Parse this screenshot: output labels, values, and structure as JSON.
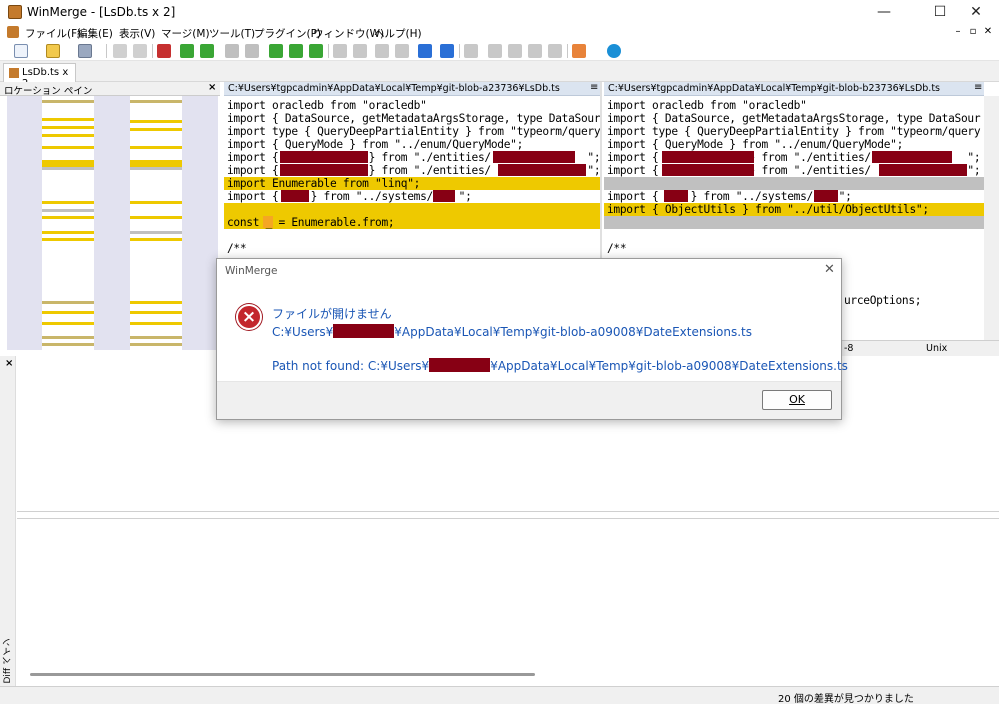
{
  "window": {
    "title": "WinMerge - [LsDb.ts x 2]",
    "controls": {
      "minimize": "—",
      "maximize": "☐",
      "close": "✕"
    }
  },
  "menubar": {
    "items": [
      "ファイル(F)",
      "編集(E)",
      "表示(V)",
      "マージ(M)",
      "ツール(T)",
      "プラグイン(P)",
      "ウィンドウ(W)",
      "ヘルプ(H)"
    ],
    "mdi_controls": [
      "–",
      "▫",
      "✕"
    ]
  },
  "tabs": [
    {
      "label": "LsDb.ts x 2"
    }
  ],
  "location_pane": {
    "title": "ロケーション ペイン",
    "close": "×"
  },
  "left_pane": {
    "path": "C:¥Users¥tgpcadmin¥AppData¥Local¥Temp¥git-blob-a23736¥LsDb.ts",
    "menu": "≡",
    "lines": [
      "import oracledb from \"oracledb\"",
      "import { DataSource, getMetadataArgsStorage, type DataSour",
      "import type { QueryDeepPartialEntity } from \"typeorm/query",
      "import { QueryMode } from \"../enum/QueryMode\";",
      "import {              } from \"./entities/               \";",
      "import {              } from \"./entities/               \";",
      "import Enumerable from \"linq\";",
      "import {     } from \"../systems/    \";",
      "",
      "const _ = Enumerable.from;",
      "",
      "/**"
    ]
  },
  "right_pane": {
    "path": "C:¥Users¥tgpcadmin¥AppData¥Local¥Temp¥git-blob-b23736¥LsDb.ts",
    "menu": "≡",
    "lines": [
      "import oracledb from \"oracledb\"",
      "import { DataSource, getMetadataArgsStorage, type DataSour",
      "import type { QueryDeepPartialEntity } from \"typeorm/query",
      "import { QueryMode } from \"../enum/QueryMode\";",
      "import {              } from \"./entities/               \";",
      "import {              } from \"./entities/               \";",
      "",
      "import {     } from \"../systems/    \";",
      "import { ObjectUtils } from \"../util/ObjectUtils\";",
      "",
      "",
      "/**"
    ],
    "partial_line": "urceOptions;"
  },
  "status": {
    "left_encoding": "",
    "right_encoding": "-8",
    "right_eol": "Unix"
  },
  "diff_pane": {
    "label": "Diff ペイン",
    "close": "×"
  },
  "statusbar": {
    "text": "20 個の差異が見つかりました"
  },
  "dialog": {
    "title": "WinMerge",
    "close": "✕",
    "icon": "error-icon",
    "heading": "ファイルが開けません",
    "path_prefix": "C:¥Users¥",
    "path_suffix": "¥AppData¥Local¥Temp¥git-blob-a09008¥DateExtensions.ts",
    "detail_prefix": "Path not found: C:¥Users¥",
    "detail_suffix": "¥AppData¥Local¥Temp¥git-blob-a09008¥DateExtensions.ts",
    "ok_label": "OK"
  },
  "colors": {
    "diff_yellow": "#eec900",
    "diff_gray": "#c0c0c0",
    "redaction": "#870014",
    "dialog_text": "#1a56b5",
    "error_red": "#c3272d"
  }
}
